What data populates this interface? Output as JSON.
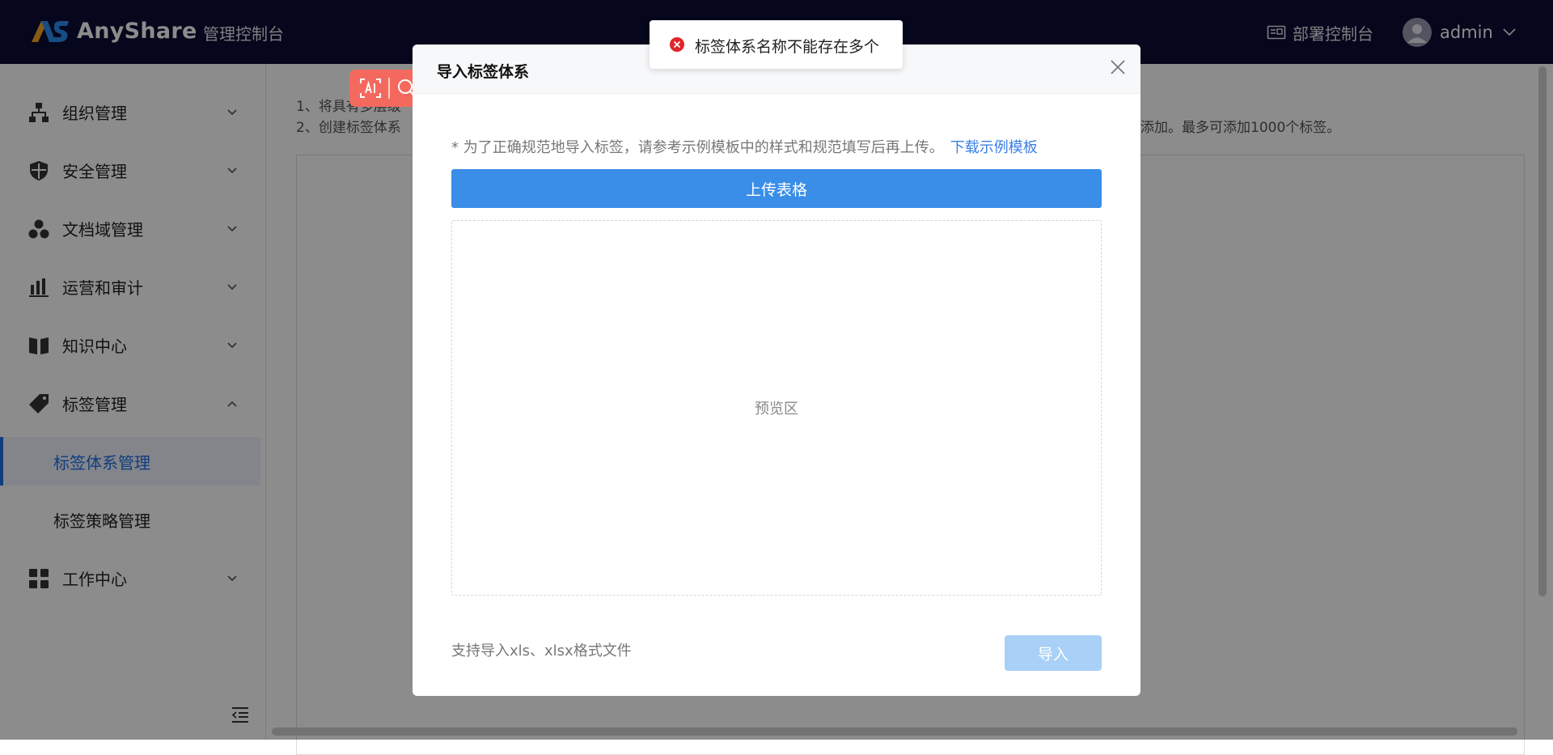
{
  "header": {
    "logo_text": "AnyShare",
    "console_title": "管理控制台",
    "deploy_link": "部署控制台",
    "username": "admin"
  },
  "sidebar": {
    "items": [
      {
        "label": "组织管理",
        "icon": "org-icon",
        "expanded": false
      },
      {
        "label": "安全管理",
        "icon": "shield-icon",
        "expanded": false
      },
      {
        "label": "文档域管理",
        "icon": "domain-icon",
        "expanded": false
      },
      {
        "label": "运营和审计",
        "icon": "bar-chart-icon",
        "expanded": false
      },
      {
        "label": "知识中心",
        "icon": "book-icon",
        "expanded": false
      },
      {
        "label": "标签管理",
        "icon": "tag-icon",
        "expanded": true
      },
      {
        "label": "工作中心",
        "icon": "grid-icon",
        "expanded": false
      }
    ],
    "sub_items": [
      {
        "label": "标签体系管理",
        "active": true
      },
      {
        "label": "标签策略管理",
        "active": false
      }
    ]
  },
  "main": {
    "help_line_1_start": "1、将具有多层级",
    "help_line_2_start": "2、创建标签体系",
    "help_line_2_end": "添加。最多可添加1000个标签。"
  },
  "modal": {
    "title": "导入标签体系",
    "hint": "* 为了正确规范地导入标签，请参考示例模板中的样式和规范填写后再上传。",
    "hint_link": "下载示例模板",
    "upload_button": "上传表格",
    "preview_label": "预览区",
    "format_note": "支持导入xls、xlsx格式文件",
    "import_button": "导入"
  },
  "toast": {
    "type": "error",
    "message": "标签体系名称不能存在多个"
  },
  "colors": {
    "header_bg": "#0b0b33",
    "primary": "#3a8ee8",
    "link": "#3a7fe6",
    "error": "#e0252b",
    "disabled_button": "#a9d0f7"
  }
}
